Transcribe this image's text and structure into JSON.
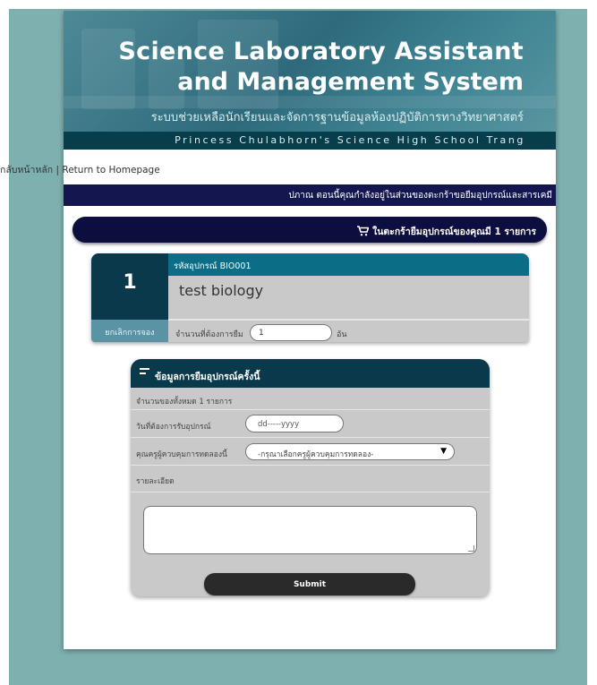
{
  "header": {
    "title_line1": "Science Laboratory Assistant",
    "title_line2": "and Management System",
    "title_th": "ระบบช่วยเหลือนักเรียนและจัดการฐานข้อมูลห้องปฏิบัติการทางวิทยาศาสตร์",
    "school": "Princess Chulabhorn's Science High School Trang"
  },
  "breadcrumb": {
    "home_th": "กลับหน้าหลัก",
    "separator": " | ",
    "home_en": "Return to Homepage"
  },
  "notice": "ปภาณ  ตอนนี้คุณกำลังอยู่ในส่วนของตะกร้าขอยืมอุปกรณ์และสารเคมี",
  "cart": {
    "text": "ในตะกร้ายืมอุปกรณ์ของคุณมี 1 รายการ",
    "icon": "cart-icon"
  },
  "item": {
    "index": "1",
    "code": "รหัสอุปกรณ์ BIO001",
    "name": "test biology",
    "cancel_label": "ยกเลิกการจอง",
    "qty_label": "จำนวนที่ต้องการยืม",
    "qty_value": "1",
    "qty_unit": "อัน"
  },
  "form": {
    "title": "ข้อมูลการยืมอุปกรณ์ครั้งนี้",
    "total": "จำนวนของทั้งหมด 1 รายการ",
    "date_label": "วันที่ต้องการรับอุปกรณ์",
    "date_placeholder": "dd-----yyyy",
    "teacher_label": "คุณครูผู้ควบคุมการทดลองนี้",
    "teacher_selected": "-กรุณาเลือกครูผู้ควบคุมการทดลอง-",
    "detail_label": "รายละเอียด",
    "detail_value": "",
    "submit_label": "Submit"
  }
}
